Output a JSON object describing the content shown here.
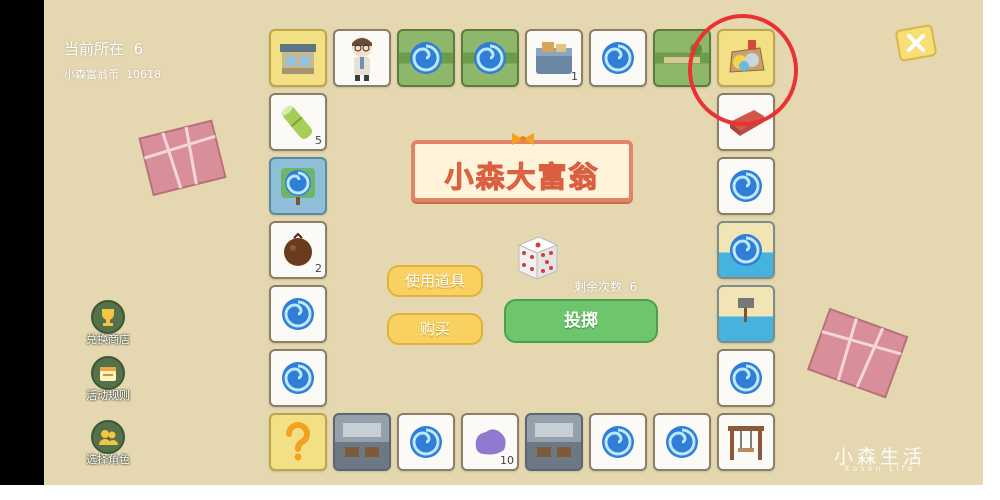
{
  "hud": {
    "position_label": "当前所在",
    "position_value": "6",
    "coin_label": "小森富翁币",
    "coin_value": "10618"
  },
  "title": "小森大富翁",
  "actions": {
    "use_item": "使用道具",
    "buy": "购买",
    "roll": "投掷",
    "remaining_label": "剩余次数",
    "remaining_value": "6"
  },
  "side_menu": [
    {
      "label": "兑换商店",
      "icon": "trophy-icon"
    },
    {
      "label": "活动规则",
      "icon": "calendar-icon"
    },
    {
      "label": "选择角色",
      "icon": "people-icon"
    }
  ],
  "tile_counts": {
    "toolbox": "1",
    "bamboo": "5",
    "coconut": "2",
    "rock": "10"
  },
  "watermark": "小森生活",
  "watermark_sub": "Xosen Life",
  "colors": {
    "background": "#e5d8b1",
    "title_text": "#f07e5e",
    "roll_button": "#6dc66b",
    "item_button": "#f8d160",
    "highlight_circle": "#ea3133"
  }
}
